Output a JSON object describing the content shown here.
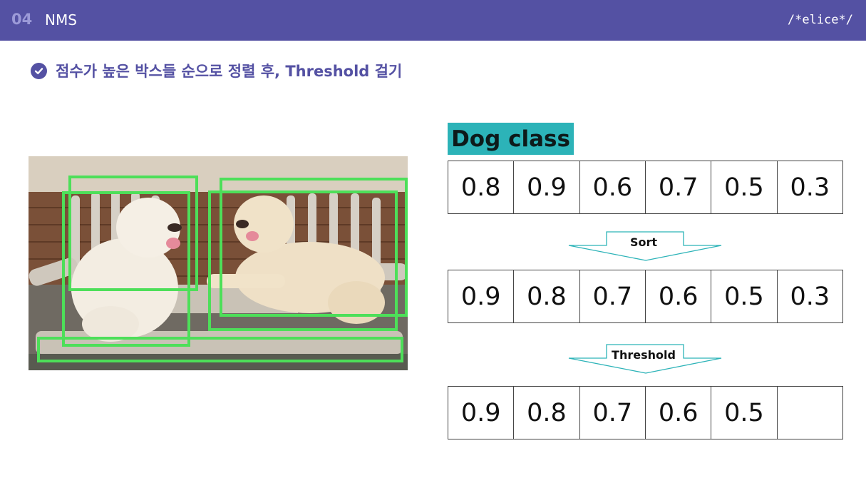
{
  "header": {
    "section_number": "04",
    "section_title": "NMS",
    "brand": "/*elice*/"
  },
  "subtitle": "점수가 높은 박스들 순으로 정렬 후, Threshold 걸기",
  "class_label": "Dog class",
  "rows": [
    [
      "0.8",
      "0.9",
      "0.6",
      "0.7",
      "0.5",
      "0.3"
    ],
    [
      "0.9",
      "0.8",
      "0.7",
      "0.6",
      "0.5",
      "0.3"
    ],
    [
      "0.9",
      "0.8",
      "0.7",
      "0.6",
      "0.5",
      ""
    ]
  ],
  "arrows": {
    "sort_label": "Sort",
    "threshold_label": "Threshold"
  },
  "colors": {
    "header_bg": "#5451a3",
    "accent_teal": "#2cb3b8",
    "box_green": "#4ddf59"
  },
  "icons": {
    "bullet": "check-circle-icon"
  }
}
